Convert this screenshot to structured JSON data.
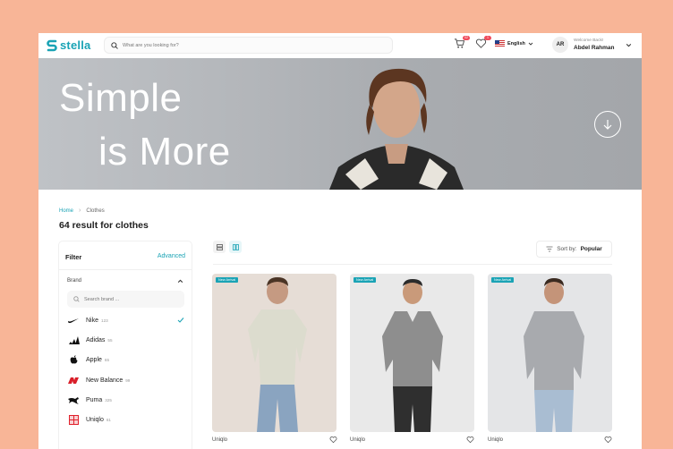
{
  "header": {
    "logo_text": "stella",
    "search_placeholder": "What are you looking for?",
    "cart_badge": "02",
    "wishlist_badge": "1",
    "language": "English",
    "avatar_initials": "AR",
    "welcome_text": "Welcome Back!",
    "user_name": "Abdel Rahman"
  },
  "hero": {
    "line1": "Simple",
    "line2": "is More"
  },
  "breadcrumb": {
    "home": "Home",
    "current": "Clothes"
  },
  "results_title": "64 result for clothes",
  "filter": {
    "title": "Filter",
    "advanced": "Advanced",
    "brand_section": "Brand",
    "brand_search_placeholder": "Search brand ...",
    "brands": [
      {
        "name": "Nike",
        "count": "123",
        "selected": true
      },
      {
        "name": "Adidas",
        "count": "55",
        "selected": false
      },
      {
        "name": "Apple",
        "count": "65",
        "selected": false
      },
      {
        "name": "New Balance",
        "count": "99",
        "selected": false
      },
      {
        "name": "Puma",
        "count": "325",
        "selected": false
      },
      {
        "name": "Uniqlo",
        "count": "61",
        "selected": false
      }
    ]
  },
  "toolbar": {
    "sort_label": "Sort by:",
    "sort_value": "Popular"
  },
  "products": [
    {
      "tag": "New Arrival",
      "brand": "Uniqlo"
    },
    {
      "tag": "New Arrival",
      "brand": "Uniqlo"
    },
    {
      "tag": "New Arrival",
      "brand": "Uniqlo"
    }
  ],
  "colors": {
    "accent": "#1aa3b5",
    "badge": "#ef4b5b",
    "background": "#f8b597"
  }
}
